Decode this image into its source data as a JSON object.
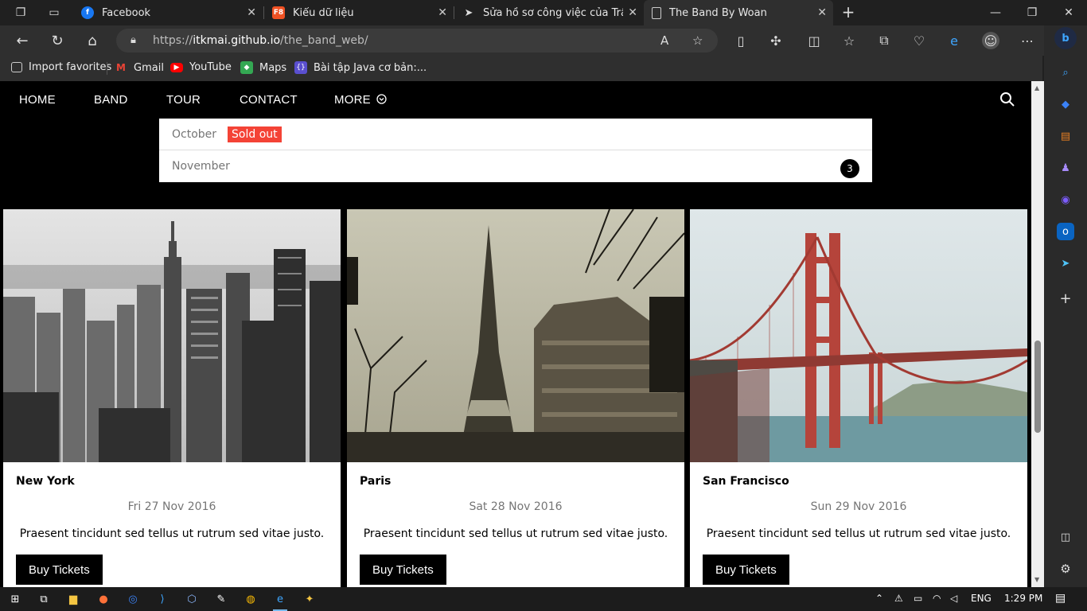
{
  "browser": {
    "tabs": [
      {
        "title": "Facebook",
        "icon": "facebook-icon",
        "color": "#1877f2",
        "glyph": "f"
      },
      {
        "title": "Kiểu dữ liệu",
        "icon": "f8-icon",
        "color": "#f05123",
        "glyph": "F8"
      },
      {
        "title": "Sửa hồ sơ công việc của Trần Kim",
        "icon": "arrow-favicon",
        "color": "#2f2f2f",
        "glyph": "➤"
      },
      {
        "title": "The Band By Woan",
        "icon": "page-icon",
        "color": "#2f2f2f",
        "glyph": ""
      }
    ],
    "url": {
      "scheme": "https://",
      "host": "itkmai.github.io",
      "path": "/the_band_web/"
    },
    "favorites": [
      {
        "label": "Import favorites",
        "icon": "import-icon"
      },
      {
        "label": "Gmail",
        "icon": "gmail-icon"
      },
      {
        "label": "YouTube",
        "icon": "youtube-icon"
      },
      {
        "label": "Maps",
        "icon": "maps-icon"
      },
      {
        "label": "Bài tập Java cơ bản:...",
        "icon": "java-icon"
      }
    ]
  },
  "site": {
    "nav": [
      "HOME",
      "BAND",
      "TOUR",
      "CONTACT",
      "MORE"
    ],
    "months": [
      {
        "name": "October",
        "tag": "Sold out"
      },
      {
        "name": "November",
        "count": "3"
      }
    ],
    "cards": [
      {
        "city": "New York",
        "date": "Fri 27 Nov 2016",
        "desc": "Praesent tincidunt sed tellus ut rutrum sed vitae justo.",
        "button": "Buy Tickets"
      },
      {
        "city": "Paris",
        "date": "Sat 28 Nov 2016",
        "desc": "Praesent tincidunt sed tellus ut rutrum sed vitae justo.",
        "button": "Buy Tickets"
      },
      {
        "city": "San Francisco",
        "date": "Sun 29 Nov 2016",
        "desc": "Praesent tincidunt sed tellus ut rutrum sed vitae justo.",
        "button": "Buy Tickets"
      }
    ]
  },
  "taskbar": {
    "lang": "ENG",
    "time": "1:29 PM"
  }
}
